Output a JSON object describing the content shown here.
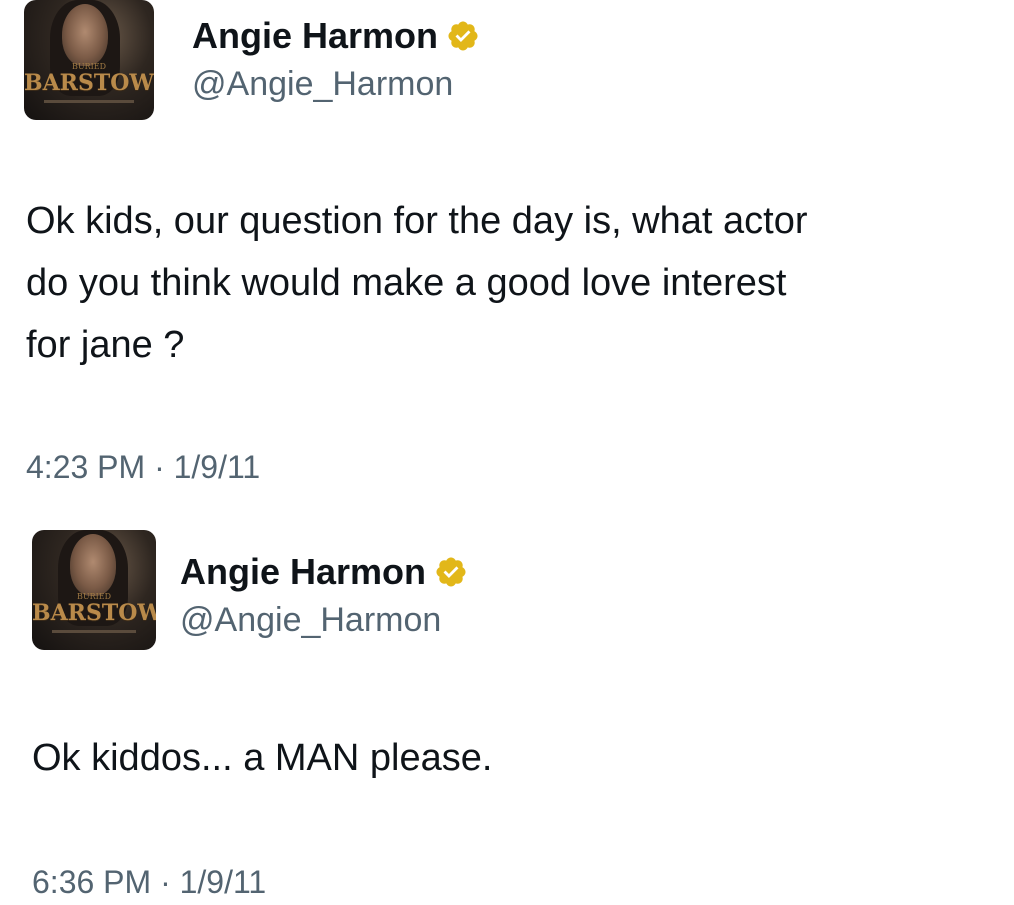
{
  "tweets": [
    {
      "display_name": "Angie Harmon",
      "handle": "@Angie_Harmon",
      "text": "Ok kids, our question for the day is, what actor\ndo you think would make a good love interest\nfor jane ?",
      "timestamp": "4:23 PM · 1/9/11",
      "avatar": {
        "book_title": "BARSTOW",
        "book_label": "BURIED"
      },
      "verified_badge_color": "#e2b719"
    },
    {
      "display_name": "Angie Harmon",
      "handle": "@Angie_Harmon",
      "text": "Ok kiddos... a MAN please.",
      "timestamp": "6:36 PM · 1/9/11",
      "avatar": {
        "book_title": "BARSTOW",
        "book_label": "BURIED"
      },
      "verified_badge_color": "#e2b719"
    }
  ],
  "icons": {
    "verified": "verified-badge-icon"
  }
}
